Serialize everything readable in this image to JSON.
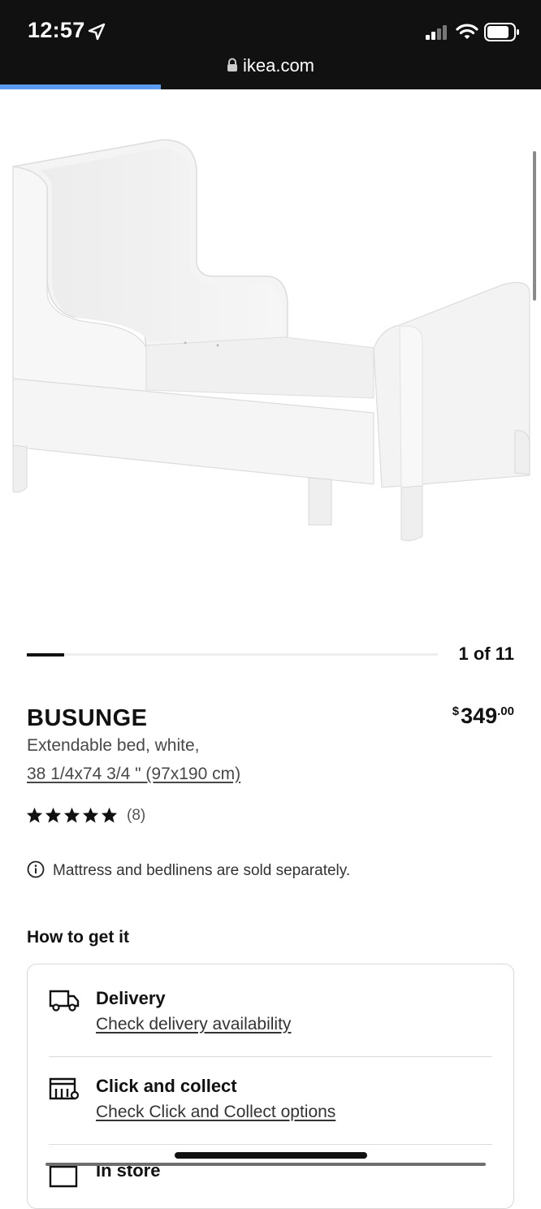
{
  "status_bar": {
    "time": "12:57",
    "url": "ikea.com"
  },
  "carousel": {
    "counter": "1 of 11",
    "current": 1,
    "total": 11
  },
  "product": {
    "name": "BUSUNGE",
    "price_currency": "$",
    "price_whole": "349",
    "price_decimal": ".00",
    "description": "Extendable bed, white,",
    "size": "38 1/4x74 3/4 \" (97x190 cm)",
    "rating": 5,
    "review_count": "(8)",
    "notice": "Mattress and bedlinens are sold separately."
  },
  "how_to_get": {
    "heading": "How to get it",
    "options": [
      {
        "icon": "truck-icon",
        "title": "Delivery",
        "link": "Check delivery availability"
      },
      {
        "icon": "store-pickup-icon",
        "title": "Click and collect",
        "link": "Check Click and Collect options"
      },
      {
        "icon": "store-icon",
        "title": "In store",
        "link": ""
      }
    ]
  },
  "colors": {
    "status_bg": "#111111",
    "progress": "#5c9cf0",
    "text": "#111111",
    "muted": "#484848"
  }
}
